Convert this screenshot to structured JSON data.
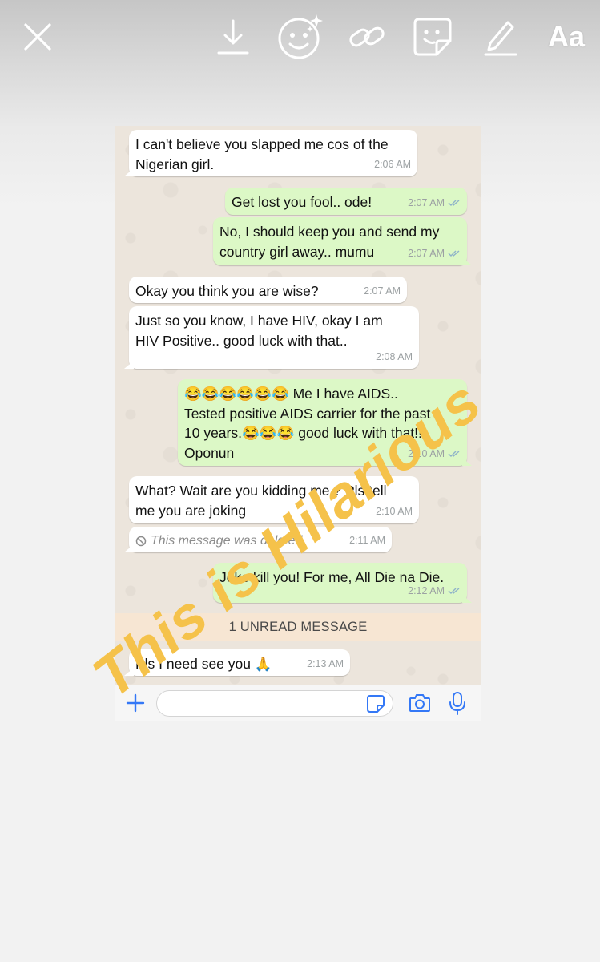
{
  "toolbar": {
    "close_icon": "close-icon",
    "download_icon": "download-icon",
    "emoji_icon": "face-sparkle-icon",
    "link_icon": "link-icon",
    "sticker_icon": "sticker-icon",
    "draw_icon": "pen-icon",
    "text_label": "Aa"
  },
  "chat": {
    "messages": [
      {
        "direction": "in",
        "text": "I can't believe you slapped me cos of the\nNigerian girl.",
        "time": "2:06 AM"
      },
      {
        "direction": "out",
        "text": "Get lost you fool.. ode!",
        "time": "2:07 AM",
        "status": "read"
      },
      {
        "direction": "out",
        "text": "No, I should keep you and send my\ncountry girl away.. mumu",
        "time": "2:07 AM",
        "status": "read"
      },
      {
        "direction": "in",
        "text": "Okay you think you are wise?",
        "time": "2:07 AM"
      },
      {
        "direction": "in",
        "text": "Just so you know, I have HIV, okay I am\nHIV Positive.. good luck with that..",
        "time": "2:08 AM"
      },
      {
        "direction": "out",
        "text": "😂😂😂😂😂😂 Me I have AIDS..\nTested positive AIDS carrier for the past\n10 years.😂😂😂 good luck with that!!\nOponun",
        "time": "2:10 AM",
        "status": "read"
      },
      {
        "direction": "in",
        "text": "What? Wait are you kidding me ? Pls tell\nme you are joking",
        "time": "2:10 AM"
      },
      {
        "direction": "in",
        "deleted": true,
        "text": "This message was deleted.",
        "time": "2:11 AM"
      },
      {
        "direction": "out",
        "text": "Joke kill you! For me, All Die na Die.",
        "time": "2:12 AM",
        "status": "read"
      },
      {
        "direction": "in",
        "text": "Pls I need see you 🙏",
        "time": "2:13 AM"
      }
    ],
    "unread_banner": "1 UNREAD MESSAGE",
    "input": {
      "placeholder": "",
      "plus_icon": "plus-icon",
      "sticker_icon": "sticker-icon",
      "camera_icon": "camera-icon",
      "mic_icon": "microphone-icon"
    }
  },
  "overlay": {
    "caption": "This is Hilarious",
    "color": "#f5c24a"
  },
  "colors": {
    "incoming_bubble": "#ffffff",
    "outgoing_bubble": "#dcf8c6",
    "chat_background": "#ece5dc",
    "accent_blue": "#3478f6"
  }
}
